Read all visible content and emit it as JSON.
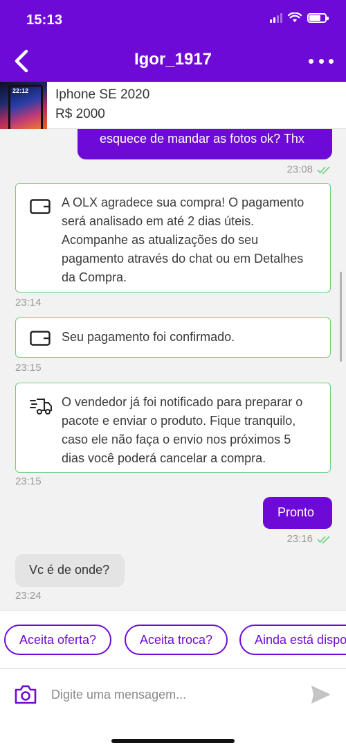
{
  "status_bar": {
    "time": "15:13"
  },
  "header": {
    "title": "Igor_1917"
  },
  "product": {
    "name": "Iphone SE 2020",
    "price": "R$ 2000",
    "thumb_time": "22:12"
  },
  "messages": [
    {
      "kind": "outgoing",
      "text": "esquece de mandar as fotos ok? Thx",
      "time": "23:08",
      "read": true
    },
    {
      "kind": "system",
      "icon": "wallet-icon",
      "text": "A OLX agradece sua compra! O pagamento será analisado em até 2 dias úteis. Acompanhe as atualizações do seu pagamento através do chat ou em Detalhes da Compra.",
      "time": "23:14"
    },
    {
      "kind": "system",
      "icon": "wallet-icon",
      "text": "Seu pagamento foi confirmado.",
      "time": "23:15"
    },
    {
      "kind": "system",
      "icon": "delivery-truck-icon",
      "text": "O vendedor já foi notificado para preparar o pacote e enviar o produto. Fique tranquilo, caso ele não faça o envio nos próximos 5 dias você poderá cancelar a compra.",
      "time": "23:15"
    },
    {
      "kind": "outgoing",
      "text": "Pronto",
      "time": "23:16",
      "read": true
    },
    {
      "kind": "incoming",
      "text": "Vc é de onde?",
      "time": "23:24"
    }
  ],
  "quick_replies": [
    "Aceita oferta?",
    "Aceita troca?",
    "Ainda está disponível?"
  ],
  "composer": {
    "placeholder": "Digite uma mensagem..."
  },
  "colors": {
    "brand": "#6e0ad6",
    "system_border": "#6ccf7b",
    "read_check": "#6ccf7b"
  }
}
